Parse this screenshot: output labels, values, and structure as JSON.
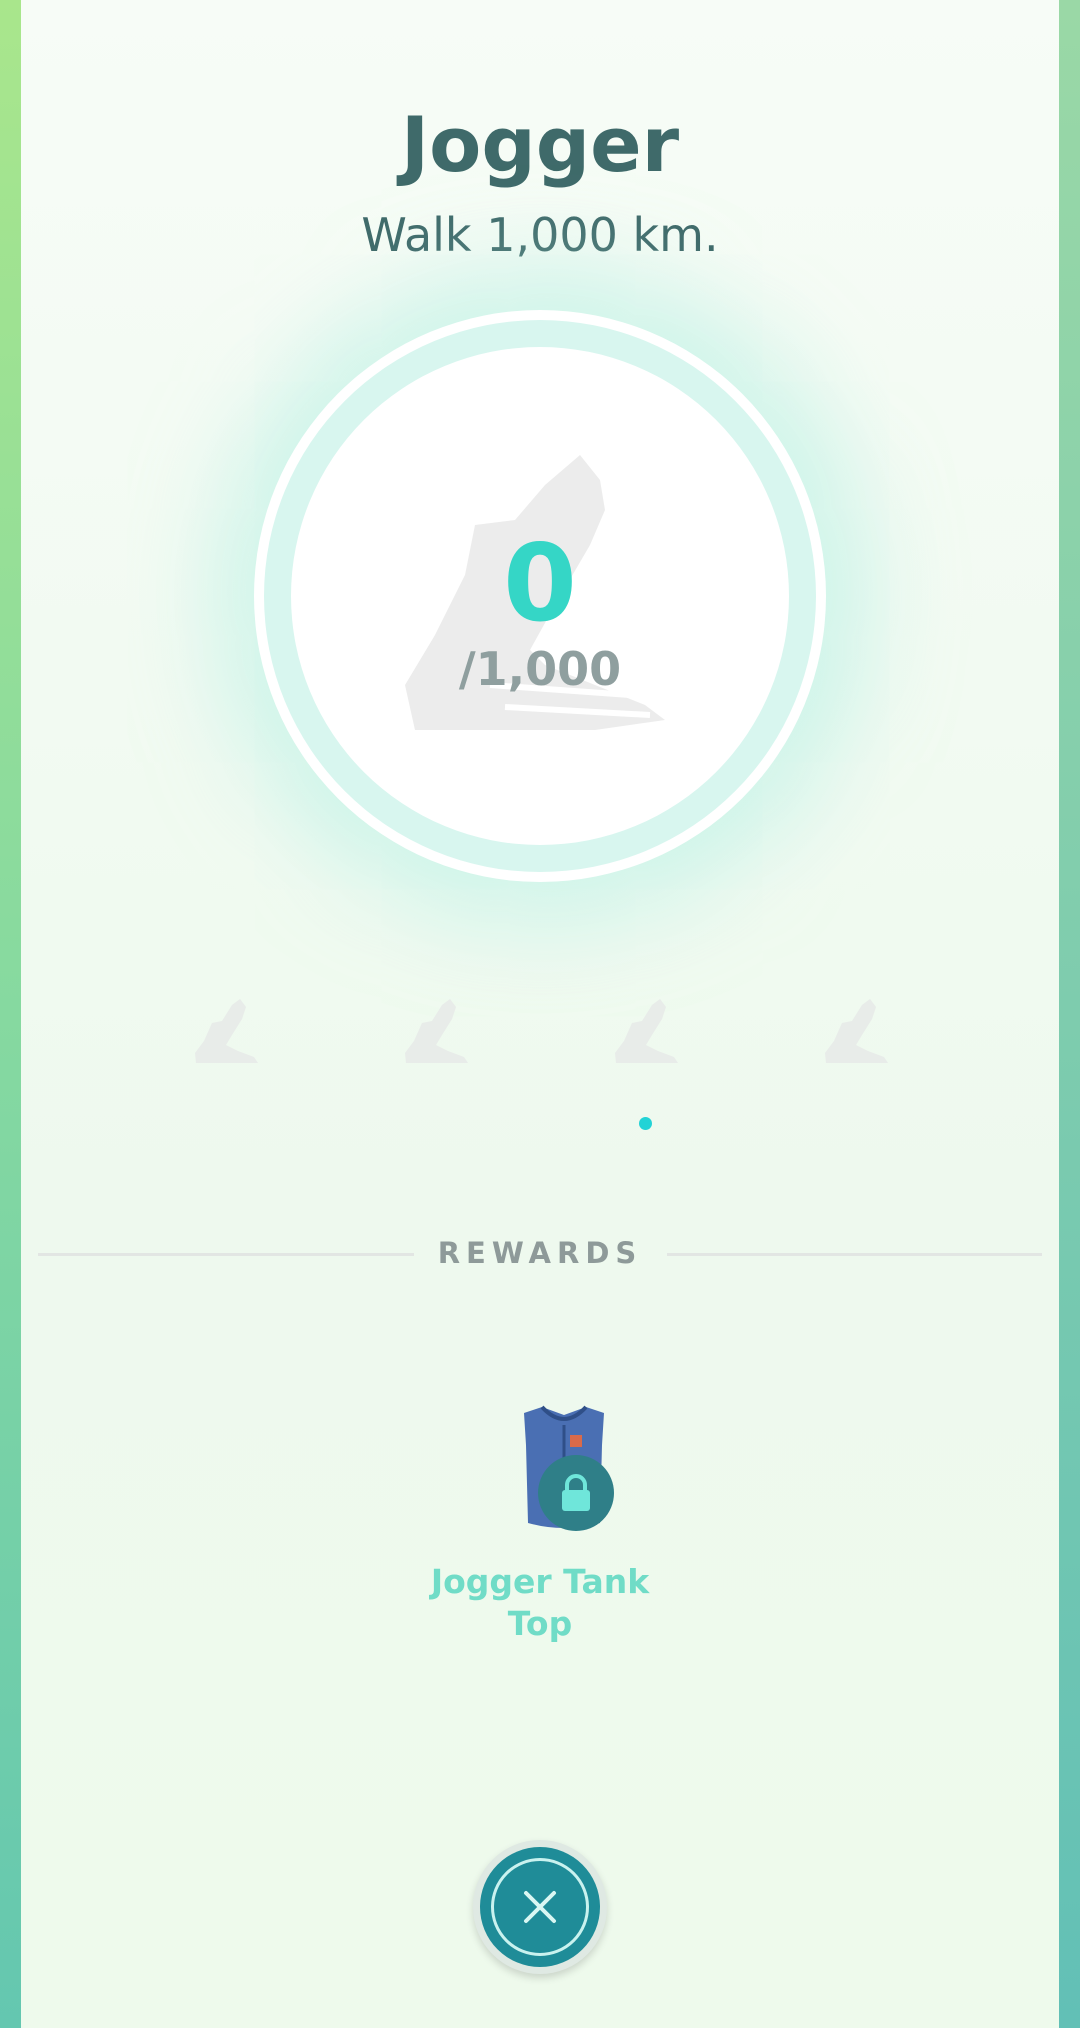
{
  "medal": {
    "title": "Jogger",
    "description": "Walk 1,000 km.",
    "progress_value": "0",
    "progress_target": "/1,000",
    "progress_fraction": 0,
    "medal_icon": "running-shoe-icon"
  },
  "tiers": {
    "icons": [
      "shoe-tier-icon",
      "shoe-tier-icon",
      "shoe-tier-icon",
      "shoe-tier-icon"
    ],
    "active_page_dot": 1
  },
  "rewards": {
    "label": "REWARDS",
    "items": [
      {
        "name": "Jogger Tank Top",
        "icon": "tank-top-icon",
        "locked": true
      }
    ]
  },
  "close": {
    "icon": "close-icon"
  },
  "colors": {
    "accent": "#35d6c6",
    "text_dark": "#3f6a6a",
    "reward_text": "#70dcc7",
    "button": "#1f8c98"
  }
}
